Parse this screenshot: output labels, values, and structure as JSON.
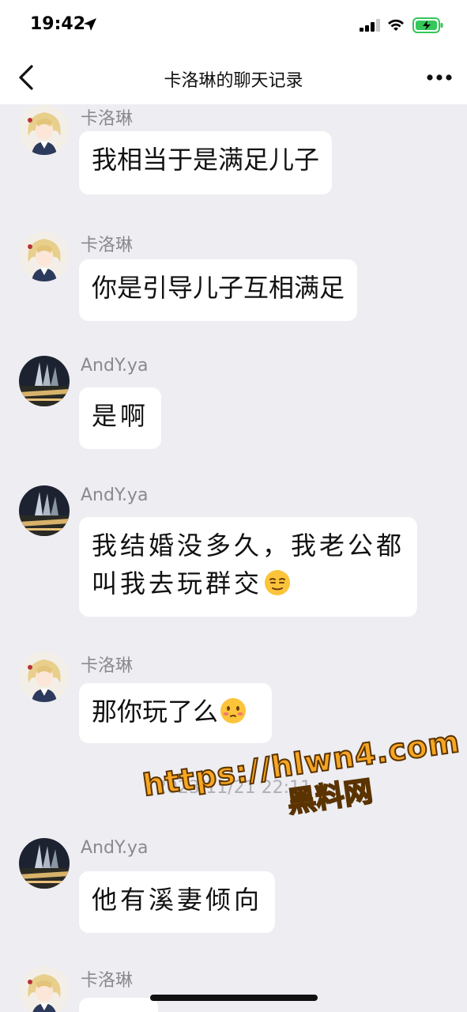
{
  "status_bar": {
    "time": "19:42",
    "battery_color": "#34c759"
  },
  "nav": {
    "title": "卡洛琳的聊天记录"
  },
  "messages": [
    {
      "sender": "卡洛琳",
      "text": "我相当于是满足儿子"
    },
    {
      "sender": "卡洛琳",
      "text": "你是引导儿子互相满足"
    },
    {
      "sender": "AndY.ya",
      "text": "是啊"
    },
    {
      "sender": "AndY.ya",
      "line1": "我结婚没多久，我老公都",
      "line2": "叫我去玩群交",
      "emoji": "smirk-emoji"
    },
    {
      "sender": "卡洛琳",
      "text": "那你玩了么",
      "emoji": "blushing-emoji"
    },
    {
      "sender": "AndY.ya",
      "text": "他有溪妻倾向"
    },
    {
      "sender": "卡洛琳",
      "text": ""
    }
  ],
  "timestamp": "2023/11/21 22:11",
  "watermark": {
    "url": "https://hlwn4.com",
    "name": "黑料网"
  },
  "colors": {
    "background": "#ededf2",
    "bubble": "#ffffff",
    "sender": "#8a8a8e",
    "watermark": "#f7a623"
  }
}
